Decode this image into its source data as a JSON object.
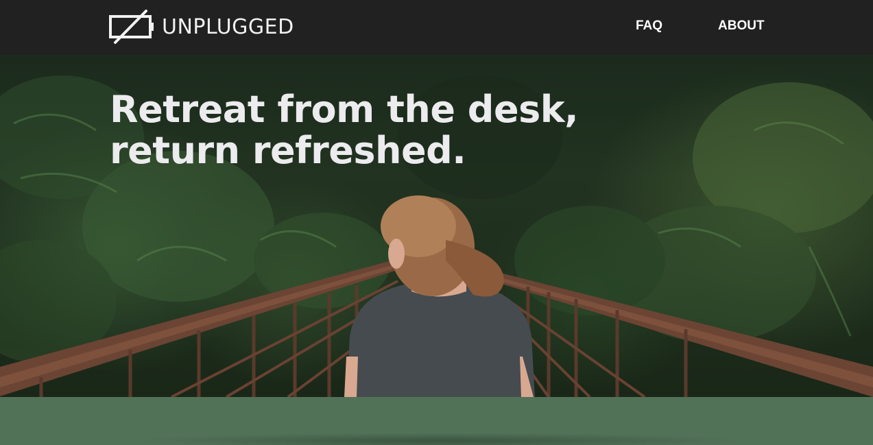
{
  "header": {
    "logo": {
      "icon": "battery-slash-icon",
      "text": "UNPLUGGED"
    },
    "nav": [
      {
        "label": "FAQ"
      },
      {
        "label": "ABOUT"
      }
    ]
  },
  "hero": {
    "headline_line1": "Retreat from the desk,",
    "headline_line2": "return refreshed.",
    "image": "woman-on-forest-bridge"
  },
  "colors": {
    "navbar": "#212121",
    "headline": "#ecebee",
    "band": "#527258"
  }
}
